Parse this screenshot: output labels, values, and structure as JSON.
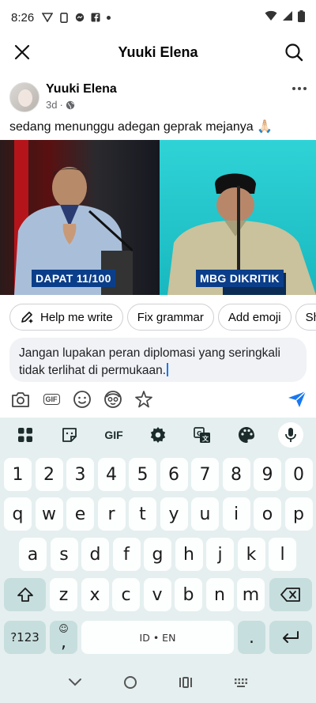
{
  "status_bar": {
    "time": "8:26"
  },
  "header": {
    "title": "Yuuki Elena"
  },
  "post": {
    "author": "Yuuki Elena",
    "time_ago": "3d",
    "audience_icon": "globe-icon",
    "text": "sedang menunggu adegan geprak mejanya 🙏🏻",
    "images": [
      {
        "caption": "DAPAT 11/100"
      },
      {
        "caption": "MBG DIKRITIK"
      }
    ]
  },
  "suggestions": [
    "Help me write",
    "Fix grammar",
    "Add emoji",
    "Sh"
  ],
  "comment": {
    "value": "Jangan lupakan peran diplomasi yang seringkali tidak terlihat di permukaan."
  },
  "keyboard": {
    "toolbar": [
      "apps-grid-icon",
      "sticker-icon",
      "GIF",
      "settings-icon",
      "translate-icon",
      "palette-icon",
      "mic-icon"
    ],
    "gif_label": "GIF",
    "row_numbers": [
      "1",
      "2",
      "3",
      "4",
      "5",
      "6",
      "7",
      "8",
      "9",
      "0"
    ],
    "row1": [
      "q",
      "w",
      "e",
      "r",
      "t",
      "y",
      "u",
      "i",
      "o",
      "p"
    ],
    "row2": [
      "a",
      "s",
      "d",
      "f",
      "g",
      "h",
      "j",
      "k",
      "l"
    ],
    "row3": [
      "z",
      "x",
      "c",
      "v",
      "b",
      "n",
      "m"
    ],
    "symbols_label": "?123",
    "comma_label": ",",
    "space_label": "ID • EN",
    "period_label": "."
  },
  "colors": {
    "accent": "#1877f2",
    "keyboard_bg": "#e5efef",
    "dark_key": "#c7dede"
  }
}
